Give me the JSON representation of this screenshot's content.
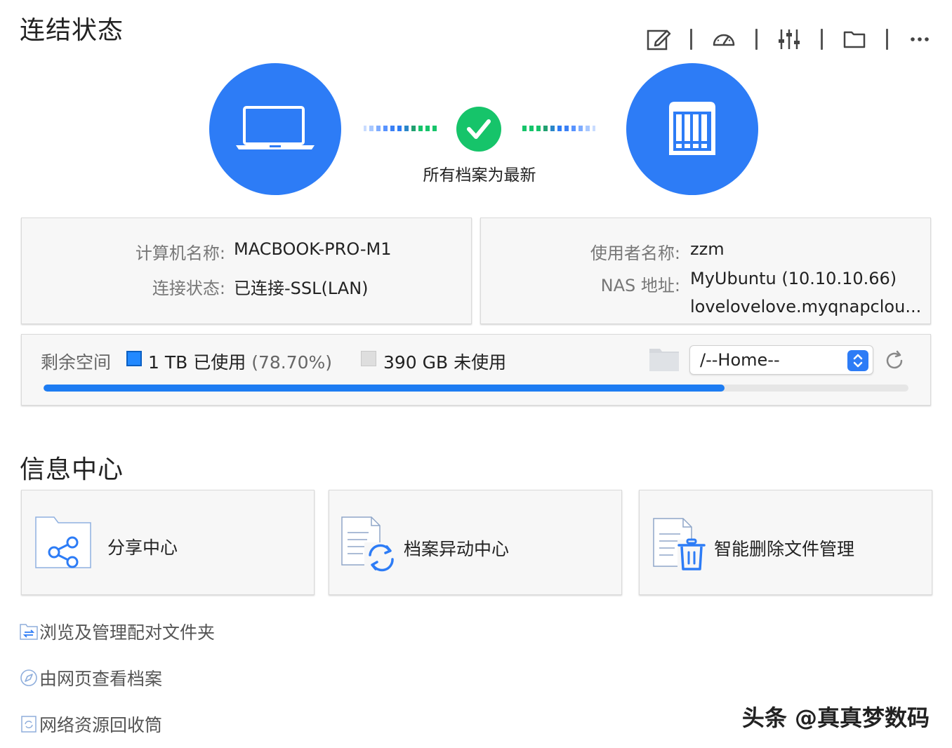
{
  "header": {
    "title": "连结状态"
  },
  "toolbar": {
    "icons": [
      "edit-icon",
      "speedometer-icon",
      "sliders-icon",
      "folder-icon",
      "more-icon"
    ]
  },
  "sync": {
    "status_text": "所有档案为最新",
    "left_device_icon": "laptop-icon",
    "right_device_icon": "nas-icon",
    "status_icon": "check-icon"
  },
  "computer_card": {
    "name_label": "计算机名称:",
    "name_value": "MACBOOK-PRO-M1",
    "status_label": "连接状态:",
    "status_value": "已连接-SSL(LAN)"
  },
  "nas_card": {
    "user_label": "使用者名称:",
    "user_value": "zzm",
    "address_label": "NAS 地址:",
    "address_value_1": "MyUbuntu (10.10.10.66)",
    "address_value_2": "lovelovelove.myqnapclou..."
  },
  "storage": {
    "label": "剩余空间",
    "used_text": "1 TB 已使用",
    "used_percent_text": "(78.70%)",
    "free_text": "390 GB 未使用",
    "used_fraction": 0.787,
    "folder_select_value": "/--Home--",
    "colors": {
      "used": "#2289ff",
      "free": "#dedede",
      "bar": "#1d7cf2"
    }
  },
  "info_center": {
    "title": "信息中心",
    "tiles": [
      {
        "label": "分享中心",
        "icon": "share-folder-icon"
      },
      {
        "label": "档案异动中心",
        "icon": "file-sync-icon"
      },
      {
        "label": "智能删除文件管理",
        "icon": "file-trash-icon"
      }
    ]
  },
  "links": [
    {
      "label": "浏览及管理配对文件夹",
      "icon": "folder-pair-icon"
    },
    {
      "label": "由网页查看档案",
      "icon": "compass-icon"
    },
    {
      "label": "网络资源回收筒",
      "icon": "recycle-bin-icon"
    }
  ],
  "watermark": "头条 @真真梦数码"
}
